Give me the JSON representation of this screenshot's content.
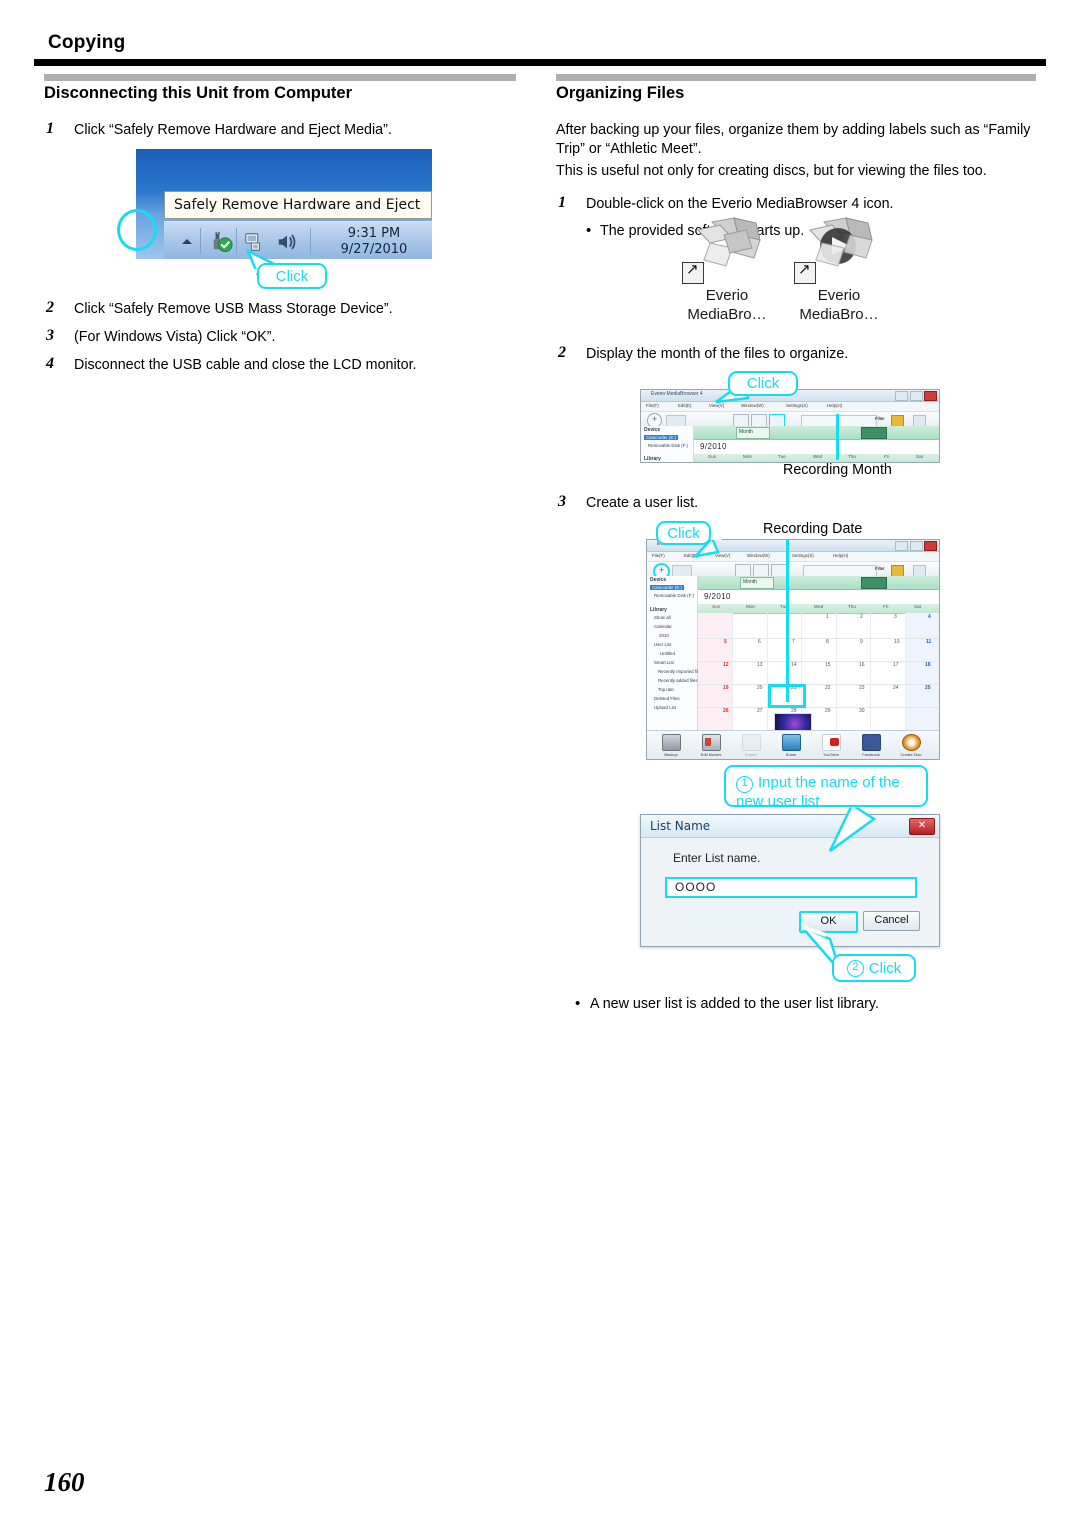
{
  "header": {
    "chapter_title": "Copying",
    "page_number": "160"
  },
  "left_column": {
    "section_title": "Disconnecting this Unit from Computer",
    "steps": [
      {
        "num": "1",
        "text": "Click “Safely Remove Hardware and Eject Media”."
      },
      {
        "num": "2",
        "text": "Click “Safely Remove USB Mass Storage Device”."
      },
      {
        "num": "3",
        "text": "(For Windows Vista) Click “OK”."
      },
      {
        "num": "4",
        "text": "Disconnect the USB cable and close the LCD monitor."
      }
    ],
    "taskbar_shot": {
      "tooltip": "Safely Remove Hardware and Eject Media",
      "clock_time": "9:31 PM",
      "clock_date": "9/27/2010",
      "callout": "Click",
      "icons": [
        "usb-eject-icon",
        "network-icon",
        "volume-icon"
      ]
    }
  },
  "right_column": {
    "section_title": "Organizing Files",
    "intro": [
      "After backing up your files, organize them by adding labels such as “Family Trip” or “Athletic Meet”.",
      "This is useful not only for creating discs, but for viewing the files too."
    ],
    "steps": [
      {
        "num": "1",
        "text": "Double-click on the Everio MediaBrowser 4 icon."
      },
      {
        "num": "2",
        "text": "Display the month of the files to organize."
      },
      {
        "num": "3",
        "text": "Create a user list."
      }
    ],
    "step1_bullet": "The provided software starts up.",
    "final_bullet": "A new user list is added to the user list library.",
    "desktop_icons": [
      {
        "line1": "Everio",
        "line2": "MediaBro…"
      },
      {
        "line1": "Everio",
        "line2": "MediaBro…"
      }
    ],
    "callouts": {
      "month_click": "Click",
      "month_caption": "Recording Month",
      "date_click": "Click",
      "date_caption": "Recording Date",
      "input_name_num": "1",
      "input_name_text": "Input the name of the new user list",
      "ok_click_num": "2",
      "ok_click_text": "Click"
    },
    "app_window": {
      "title": "Everio MediaBrowser 4",
      "menus": [
        "File(F)",
        "Edit(E)",
        "View(V)",
        "Window(W)",
        "Settings(S)",
        "Help(H)"
      ],
      "toolbar": {
        "add_label": "+",
        "filter_label": "Filter"
      },
      "device_header": "Device",
      "device_items": [
        "Camcorder (E:)",
        "Removable Disk (F:)"
      ],
      "library_header": "Library",
      "library_items": [
        "Show all",
        "Calendar",
        "2010",
        "User List",
        "Untitled",
        "Smart List",
        "Recently Imported files",
        "Recently added files",
        "Top rate",
        "Deleted Files",
        "Upload List"
      ],
      "month_label": "Month",
      "year_month": "9/2010",
      "weekdays": [
        "Sun",
        "Mon",
        "Tue",
        "Wed",
        "Thu",
        "Fri",
        "Sat"
      ],
      "week_rows": [
        [
          "",
          "",
          "",
          "1",
          "2",
          "3",
          "4"
        ],
        [
          "5",
          "6",
          "7",
          "8",
          "9",
          "10",
          "11"
        ],
        [
          "12",
          "13",
          "14",
          "15",
          "16",
          "17",
          "18"
        ],
        [
          "19",
          "20",
          "21",
          "22",
          "23",
          "24",
          "25"
        ],
        [
          "26",
          "27",
          "28",
          "29",
          "30",
          "",
          ""
        ]
      ],
      "footer_buttons": [
        "Backup",
        "Edit Movies",
        "Export",
        "Share",
        "YouTube",
        "Facebook",
        "Create Disc"
      ]
    },
    "dialog": {
      "title": "List Name",
      "label": "Enter List name.",
      "input_value": "ΟΟΟΟ",
      "ok_label": "OK",
      "cancel_label": "Cancel",
      "close_label": "✕"
    }
  },
  "colors": {
    "callout_cyan": "#15dcf2",
    "rule_black": "#000000",
    "section_bar_gray": "#b0b0b0"
  }
}
